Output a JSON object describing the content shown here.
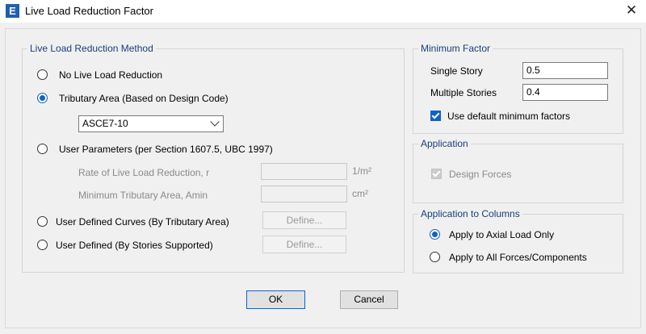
{
  "window": {
    "title": "Live Load Reduction Factor",
    "icon_letter": "E",
    "close_glyph": "✕"
  },
  "method": {
    "title": "Live Load Reduction Method",
    "no_reduction": "No Live Load Reduction",
    "tributary": "Tributary Area (Based on Design Code)",
    "code_value": "ASCE7-10",
    "user_params": "User Parameters (per Section 1607.5, UBC 1997)",
    "rate_label": "Rate of Live Load Reduction, r",
    "rate_unit": "1/m²",
    "min_area_label": "Minimum Tributary Area, Amin",
    "min_area_unit": "cm²",
    "curves": "User Defined Curves (By Tributary Area)",
    "stories": "User Defined (By Stories Supported)",
    "define_label": "Define...",
    "selected": "tributary"
  },
  "minimum_factor": {
    "title": "Minimum Factor",
    "single_label": "Single Story",
    "single_value": "0.5",
    "multiple_label": "Multiple Stories",
    "multiple_value": "0.4",
    "use_default_label": "Use default minimum factors",
    "use_default_checked": true
  },
  "application": {
    "title": "Application",
    "design_forces_label": "Design Forces",
    "design_forces_checked": true
  },
  "columns": {
    "title": "Application to Columns",
    "axial": "Apply to Axial Load Only",
    "all": "Apply to All Forces/Components",
    "selected": "axial"
  },
  "buttons": {
    "ok": "OK",
    "cancel": "Cancel"
  }
}
